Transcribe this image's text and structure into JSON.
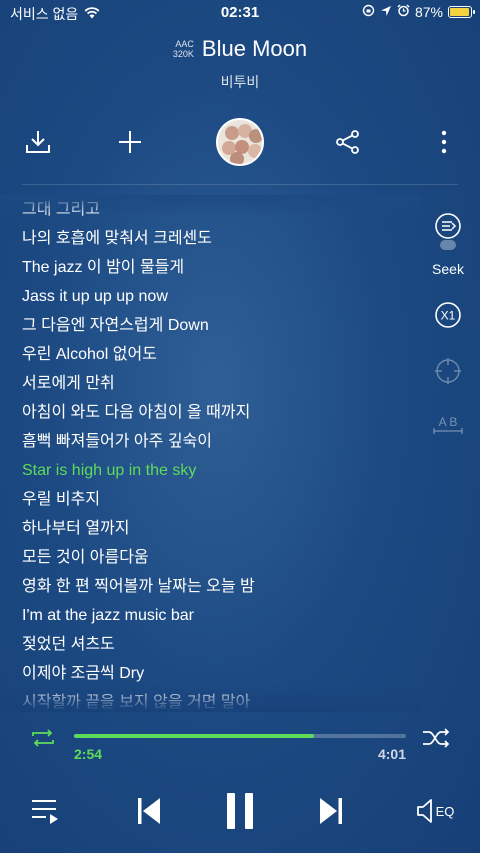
{
  "status_bar": {
    "carrier": "서비스 없음",
    "time": "02:31",
    "battery": "87%"
  },
  "track": {
    "codec_line1": "AAC",
    "codec_line2": "320K",
    "title": "Blue Moon",
    "artist": "비투비"
  },
  "actions": {
    "icons": [
      "download-icon",
      "add-icon",
      "album-art",
      "share-icon",
      "more-icon"
    ]
  },
  "lyrics": [
    "그대 그리고",
    "나의 호흡에 맞춰서 크레센도",
    "The jazz 이 밤이 물들게",
    "Jass it up up up now",
    "그 다음엔 자연스럽게 Down",
    "우린 Alcohol 없어도",
    "서로에게 만취",
    "아침이 와도 다음 아침이 올 때까지",
    "흠뻑 빠져들어가 아주 깊숙이",
    "Star is high up in the sky",
    "우릴 비추지",
    "하나부터 열까지",
    "모든 것이 아름다움",
    "영화 한 편 찍어볼까 날짜는 오늘 밤",
    "I'm at the jazz music bar",
    "젖었던 셔츠도",
    "이제야 조금씩 Dry",
    "시작할까 끝을 보지 않을 거면 말아"
  ],
  "active_lyric_index": 9,
  "side_controls": {
    "seek_label": "Seek",
    "speed_label": "X1",
    "ab_label": "A B"
  },
  "progress": {
    "elapsed": "2:54",
    "total": "4:01",
    "fraction": 0.722
  },
  "colors": {
    "accent": "#5edb5a",
    "background": "#1d4a83",
    "battery": "#f5d33c"
  }
}
